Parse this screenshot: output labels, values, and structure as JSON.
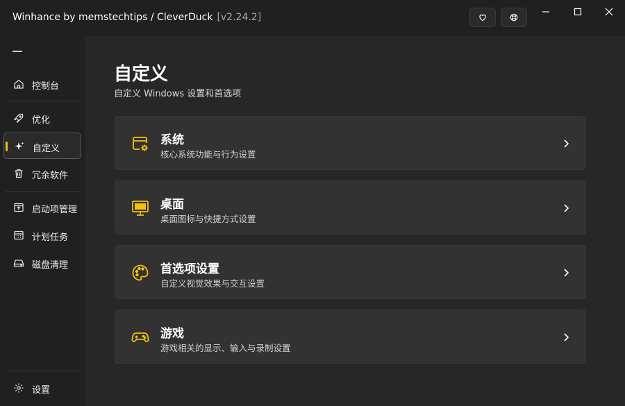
{
  "titlebar": {
    "app_name": "Winhance by memstechtips / CleverDuck",
    "version": "[v2.24.2]",
    "donate_icon": "heart-icon",
    "theme_icon": "palette-icon"
  },
  "sidebar": {
    "items": [
      {
        "label": "控制台",
        "icon": "home-icon"
      },
      {
        "label": "优化",
        "icon": "rocket-icon"
      },
      {
        "label": "自定义",
        "icon": "sparkle-icon"
      },
      {
        "label": "冗余软件",
        "icon": "trash-icon"
      },
      {
        "label": "启动项管理",
        "icon": "startup-icon"
      },
      {
        "label": "计划任务",
        "icon": "calendar-icon"
      },
      {
        "label": "磁盘清理",
        "icon": "disk-icon"
      }
    ],
    "settings_label": "设置"
  },
  "main": {
    "title": "自定义",
    "subtitle": "自定义 Windows 设置和首选项",
    "cards": [
      {
        "title": "系统",
        "description": "核心系统功能与行为设置",
        "icon": "system-window-gear-icon"
      },
      {
        "title": "桌面",
        "description": "桌面图标与快捷方式设置",
        "icon": "monitor-icon"
      },
      {
        "title": "首选项设置",
        "description": "自定义视觉效果与交互设置",
        "icon": "palette-icon"
      },
      {
        "title": "游戏",
        "description": "游戏相关的显示、输入与录制设置",
        "icon": "gamepad-icon"
      }
    ]
  },
  "colors": {
    "accent": "#f4c20d",
    "background": "#272727",
    "sidebar": "#202020",
    "card": "#323232"
  }
}
